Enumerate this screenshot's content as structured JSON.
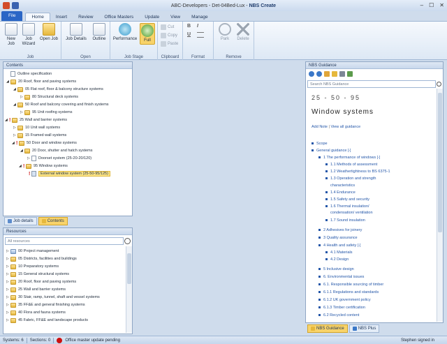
{
  "window": {
    "title_prefix": "ABC-Developers - Det-04Bed-Lux - ",
    "title_app": "NBS Create",
    "minimize": "–",
    "maximize": "☐",
    "close": "✕"
  },
  "tabs": [
    "File",
    "Home",
    "Insert",
    "Review",
    "Office Masters",
    "Update",
    "View",
    "Manage"
  ],
  "ribbon": {
    "groups": {
      "job": "Job",
      "open": "Open",
      "job_stage": "Job Stage",
      "clipboard": "Clipboard",
      "format": "Format",
      "remove": "Remove"
    },
    "buttons": {
      "new_job": "New Job",
      "job_wizard": "Job Wizard",
      "open_job": "Open Job",
      "job_details": "Job Details",
      "outline": "Outline",
      "performance": "Performance",
      "full": "Full",
      "cut": "Cut",
      "copy": "Copy",
      "paste": "Paste",
      "bold": "B",
      "italic": "I",
      "underline": "U",
      "park": "Park",
      "delete": "Delete"
    }
  },
  "contents": {
    "title": "Contents",
    "items": [
      "Outline specification",
      "20 Roof, floor and paving systems",
      "05 Flat roof, floor & balcony structure systems",
      "80 Structural deck systems",
      "50 Roof and balcony covering and finish systems",
      "95 Unit roofing systems",
      "25 Wall and barrier systems",
      "10 Unit wall systems",
      "15 Framed wall systems",
      "50 Door and window systems",
      "20 Door, shutter and hatch systems",
      "Doorset system  (25-20-20/120)",
      "95 Window systems",
      "External window system  (25-50-95/125)"
    ],
    "tabs": [
      "Job details",
      "Contents"
    ]
  },
  "resources": {
    "title": "Resources",
    "search_placeholder": "All resources",
    "items": [
      "00 Project management",
      "05 Districts, facilities and buildings",
      "10 Preparatory systems",
      "15 General structural systems",
      "20 Roof, floor and paving systems",
      "25 Wall and barrier systems",
      "30 Stair, ramp, tunnel, shaft and vessel systems",
      "35 FF&E and general finishing systems",
      "40 Flora and fauna systems",
      "45 Fabric, FF&E and landscape products"
    ]
  },
  "guidance": {
    "title": "NBS Guidance",
    "search_placeholder": "Search NBS Guidance",
    "code": "25 - 50 - 95",
    "heading": "Window systems",
    "add_note": "Add Note",
    "view_all": "View all guidance",
    "separator": "|",
    "toggle": "[-]",
    "items": [
      {
        "text": "Scope",
        "level": 0
      },
      {
        "text": "General guidance",
        "level": 0,
        "toggle": true
      },
      {
        "text": "1 The performance of windows",
        "level": 1,
        "toggle": true
      },
      {
        "text": "1.1 Methods of assessment",
        "level": 2
      },
      {
        "text": "1.2 Weathertightness to BS 6375-1",
        "level": 2
      },
      {
        "text": "1.3 Operation and strength",
        "level": 2
      },
      {
        "text": "characteristics",
        "level": 3
      },
      {
        "text": "1.4 Endurance",
        "level": 2
      },
      {
        "text": "1.5 Safety and security",
        "level": 2
      },
      {
        "text": "1.6 Thermal insulation/",
        "level": 2
      },
      {
        "text": "condensation/ ventilation",
        "level": 3
      },
      {
        "text": "1.7 Sound insulation",
        "level": 2
      },
      {
        "text": "2 Adhesives for joinery",
        "level": 1
      },
      {
        "text": "3 Quality assurance",
        "level": 1
      },
      {
        "text": "4 Health and safety",
        "level": 1,
        "toggle": true
      },
      {
        "text": "4.1 Materials",
        "level": 2
      },
      {
        "text": "4.2 Design",
        "level": 2
      },
      {
        "text": "5 Inclusive design",
        "level": 1
      },
      {
        "text": "6. Environmental issues",
        "level": 1
      },
      {
        "text": "6.1. Responsible sourcing of timber",
        "level": 1
      },
      {
        "text": "6.1.1 Regulations and standards",
        "level": 1
      },
      {
        "text": "6.1.2 UK government policy",
        "level": 1
      },
      {
        "text": "6.1.3 Timber certification",
        "level": 1
      },
      {
        "text": "6.2 Recycled content",
        "level": 1
      }
    ],
    "tabs": [
      "NBS Guidance",
      "NBS Plus"
    ]
  },
  "status": {
    "systems": "Systems: 6",
    "sections": "Sections: 0",
    "update": "Office master update pending",
    "user": "Stephen signed in"
  },
  "colors": {
    "accent": "#2a66c6",
    "highlight": "#f8d36a",
    "link": "#2356a8",
    "warning": "#cc1010"
  }
}
